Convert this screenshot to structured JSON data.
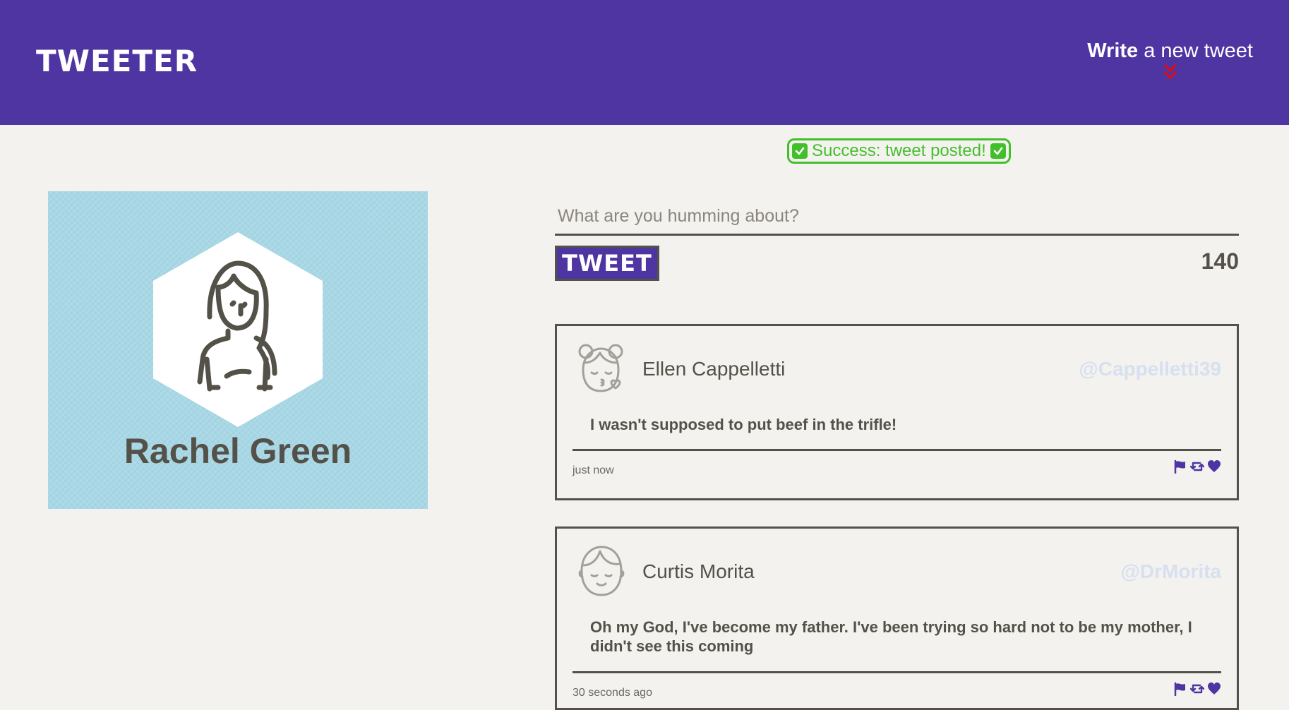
{
  "nav": {
    "brand": "TWEETER",
    "compose_toggle": {
      "bold": "Write",
      "rest": " a new tweet"
    },
    "chevron_color": "#d0101f"
  },
  "status": {
    "success_message": "Success: tweet posted!"
  },
  "profile": {
    "name": "Rachel Green",
    "avatar": "woman-avatar-icon"
  },
  "compose": {
    "placeholder": "What are you humming about?",
    "value": "",
    "submit_label": "TWEET",
    "char_counter": "140"
  },
  "tweets": [
    {
      "author": "Ellen Cappelletti",
      "handle": "@Cappelletti39",
      "avatar": "girl-kiss-avatar-icon",
      "text": "I wasn't supposed to put beef in the trifle!",
      "timestamp": "just now",
      "actions": [
        "flag-icon",
        "retweet-icon",
        "heart-icon"
      ]
    },
    {
      "author": "Curtis Morita",
      "handle": "@DrMorita",
      "avatar": "boy-avatar-icon",
      "text": "Oh my God, I've become my father. I've been trying so hard not to be my mother, I didn't see this coming",
      "timestamp": "30 seconds ago",
      "actions": [
        "flag-icon",
        "retweet-icon",
        "heart-icon"
      ]
    }
  ],
  "colors": {
    "nav_bg": "#4f35a2",
    "page_bg": "#f4f2ef",
    "text": "#545149",
    "success": "#43bf2b",
    "handle": "#d6e0ef",
    "profile_bg": "#a8d8e6",
    "accent": "#4f35a2"
  }
}
